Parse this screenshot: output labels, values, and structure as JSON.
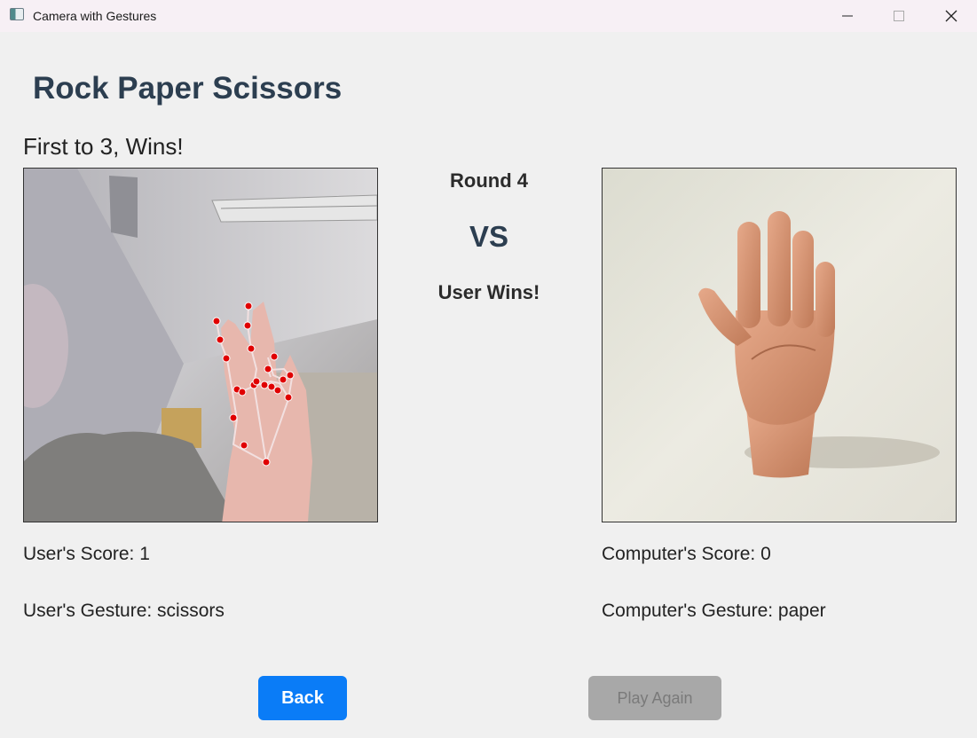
{
  "window": {
    "title": "Camera with Gestures",
    "controls": [
      "minimize-icon",
      "maximize-icon",
      "close-icon"
    ]
  },
  "app": {
    "title": "Rock Paper Scissors",
    "subtitle": "First to 3, Wins!"
  },
  "match": {
    "round_label": "Round 4",
    "vs_label": "VS",
    "result_label": "User Wins!"
  },
  "user": {
    "score_label": "User's Score: 1",
    "gesture_label": "User's Gesture: scissors",
    "score": 1,
    "gesture": "scissors"
  },
  "computer": {
    "score_label": "Computer's Score: 0",
    "gesture_label": "Computer's Gesture: paper",
    "score": 0,
    "gesture": "paper"
  },
  "buttons": {
    "back_label": "Back",
    "play_again_label": "Play Again",
    "back_color": "#0a7cf7",
    "play_again_color": "#a8a8a8"
  },
  "colors": {
    "title": "#2c3e50",
    "landmark": "#e00000"
  }
}
